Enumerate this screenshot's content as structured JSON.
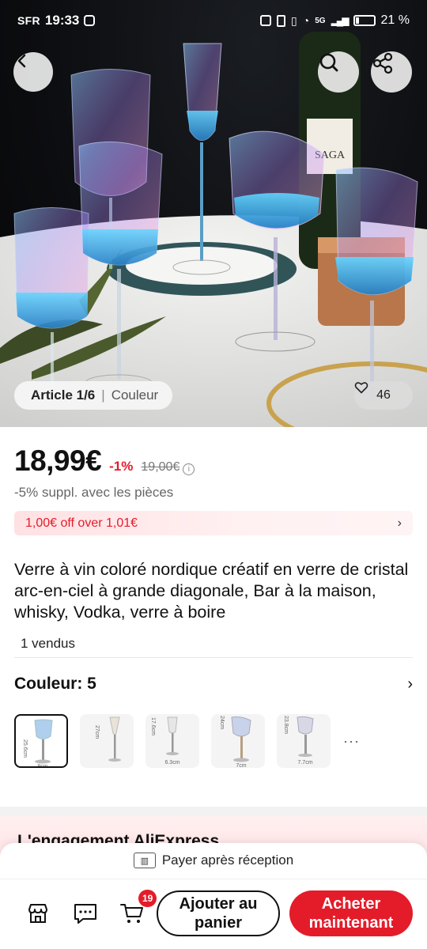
{
  "status_bar": {
    "carrier": "SFR",
    "time": "19:33",
    "network": "5G",
    "battery": "21 %"
  },
  "hero": {
    "image_position": "Article 1/6",
    "variant_label": "Couleur",
    "likes": "46",
    "bottle_label": "SAGA"
  },
  "product": {
    "price": "18,99€",
    "discount": "-1%",
    "original_price": "19,00€",
    "extra_discount": "-5% suppl. avec les pièces",
    "coupon": "1,00€ off over 1,01€",
    "title": "Verre à vin coloré nordique créatif en verre de cristal arc-en-ciel à grande diagonale, Bar à la maison, whisky, Vodka, verre à boire",
    "sold": "1 vendus"
  },
  "colors": {
    "label": "Couleur: 5",
    "swatches": [
      {
        "height": "25.6cm",
        "width": "8cm"
      },
      {
        "height": "27cm",
        "width": ""
      },
      {
        "height": "17.6cm",
        "width": "6.3cm"
      },
      {
        "height": "24cm",
        "width": "7cm"
      },
      {
        "height": "23.8cm",
        "width": "7.7cm"
      }
    ],
    "more": "···"
  },
  "pledge": {
    "title": "L'engagement AliExpress"
  },
  "bottom_bar": {
    "pay_after": "Payer après réception",
    "cart_count": "19",
    "add_to_cart": "Ajouter au panier",
    "buy_now": "Acheter maintenant"
  },
  "icons": [
    "back-icon",
    "search-icon",
    "share-icon",
    "heart-icon",
    "info-icon",
    "chevron-right-icon",
    "store-icon",
    "chat-icon",
    "cart-icon",
    "pay-after-icon"
  ],
  "colors_theme": {
    "accent": "#e41c2a",
    "coupon_bg": "#ffe1e3"
  }
}
